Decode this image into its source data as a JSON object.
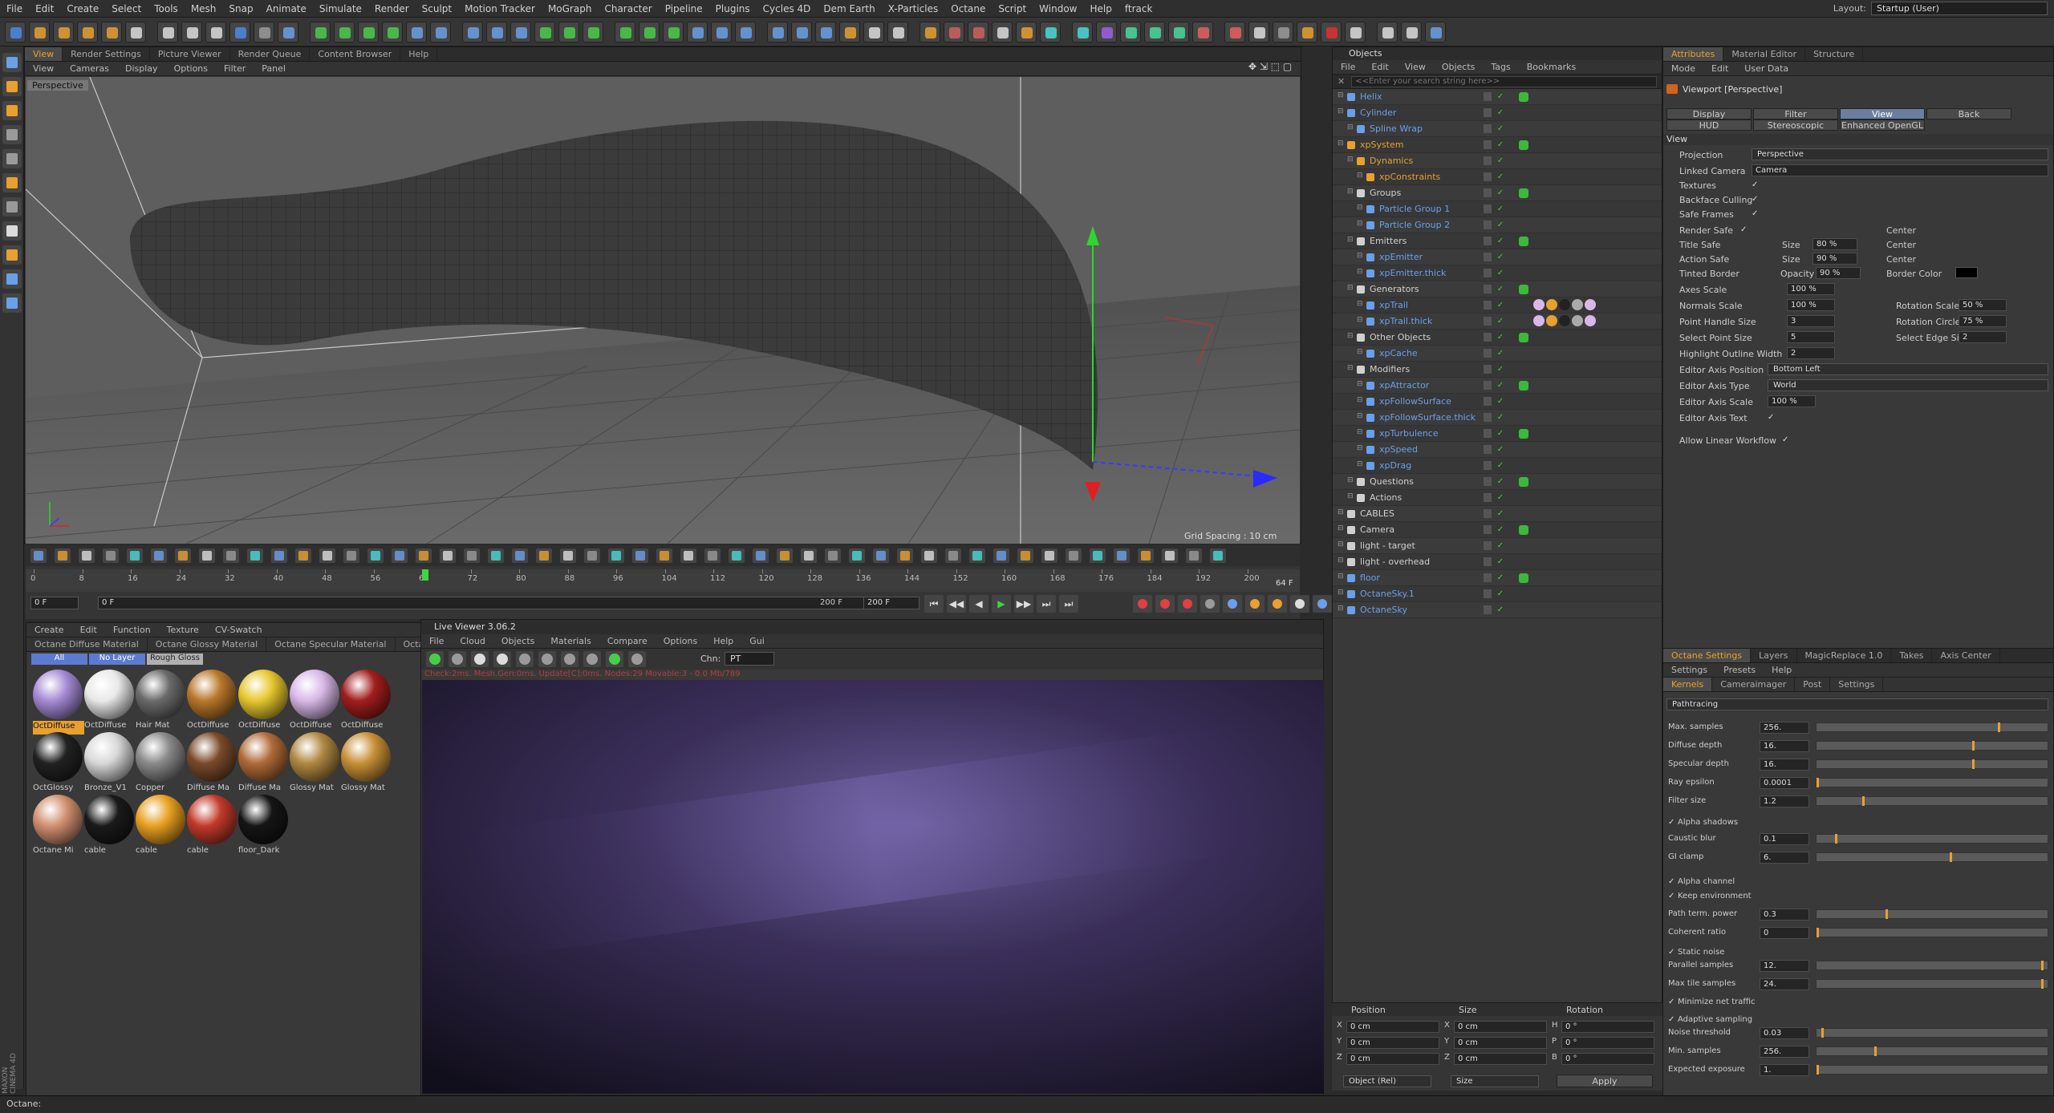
{
  "menu": [
    "File",
    "Edit",
    "Create",
    "Select",
    "Tools",
    "Mesh",
    "Snap",
    "Animate",
    "Simulate",
    "Render",
    "Sculpt",
    "Motion Tracker",
    "MoGraph",
    "Character",
    "Pipeline",
    "Plugins",
    "Cycles 4D",
    "Dem Earth",
    "X-Particles",
    "Octane",
    "Script",
    "Window",
    "Help",
    "ftrack"
  ],
  "layout": {
    "label": "Layout:",
    "value": "Startup (User)"
  },
  "viewport": {
    "tabs": [
      "View",
      "Render Settings",
      "Picture Viewer",
      "Render Queue",
      "Content Browser",
      "Help"
    ],
    "menu": [
      "View",
      "Cameras",
      "Display",
      "Options",
      "Filter",
      "Panel"
    ],
    "label": "Perspective",
    "grid_spacing": "Grid Spacing : 10 cm"
  },
  "timeline": {
    "ticks": [
      "0",
      "8",
      "16",
      "24",
      "32",
      "40",
      "48",
      "56",
      "64",
      "72",
      "80",
      "88",
      "96",
      "104",
      "112",
      "120",
      "128",
      "136",
      "144",
      "152",
      "160",
      "168",
      "176",
      "184",
      "192",
      "200"
    ],
    "current": "64 F",
    "start": "0 F",
    "start2": "0 F",
    "end": "200 F",
    "end2": "200 F"
  },
  "materials": {
    "menu": [
      "Create",
      "Edit",
      "Function",
      "Texture",
      "CV-Swatch"
    ],
    "tabs": [
      "Octane Diffuse Material",
      "Octane Glossy Material",
      "Octane Specular Material",
      "Octane M"
    ],
    "filters": [
      "All",
      "No Layer",
      "Rough Gloss"
    ],
    "items": [
      {
        "label": "OctDiffuse",
        "color": "#a78bd6"
      },
      {
        "label": "OctDiffuse",
        "color": "#e9e9e9"
      },
      {
        "label": "Hair Mat",
        "color": "#6b6b6b"
      },
      {
        "label": "OctDiffuse",
        "color": "#b8772a"
      },
      {
        "label": "OctDiffuse",
        "color": "#e7c72e"
      },
      {
        "label": "OctDiffuse",
        "color": "#d8b8e8"
      },
      {
        "label": "OctDiffuse",
        "color": "#a21d1d"
      },
      {
        "label": "OctGlossy",
        "color": "#222222"
      },
      {
        "label": "Bronze_V1",
        "color": "#d8d8d8"
      },
      {
        "label": "Copper",
        "color": "#8a8a8a"
      },
      {
        "label": "Diffuse Ma",
        "color": "#7a4a2a"
      },
      {
        "label": "Diffuse Ma",
        "color": "#b06a38"
      },
      {
        "label": "Glossy Mat",
        "color": "#b08840"
      },
      {
        "label": "Glossy Mat",
        "color": "#c89038"
      },
      {
        "label": "Octane Mi",
        "color": "#d29070"
      },
      {
        "label": "cable",
        "color": "#1a1a1a"
      },
      {
        "label": "cable",
        "color": "#e8a020"
      },
      {
        "label": "cable",
        "color": "#c23a2a"
      },
      {
        "label": "floor_Dark",
        "color": "#151515"
      }
    ]
  },
  "live_viewer": {
    "title": "Live Viewer 3.06.2",
    "menu": [
      "File",
      "Cloud",
      "Objects",
      "Materials",
      "Compare",
      "Options",
      "Help",
      "Gui"
    ],
    "chn_label": "Chn:",
    "chn_value": "PT",
    "status": "Check:2ms. Mesh.Gen:0ms. Update[C]:0ms. Nodes:29 Movable:3 - 0.0 Mb/789"
  },
  "objects": {
    "title": "Objects",
    "menu": [
      "File",
      "Edit",
      "View",
      "Objects",
      "Tags",
      "Bookmarks"
    ],
    "search_placeholder": "<<Enter your search string here>>",
    "rows": [
      {
        "name": "Helix",
        "indent": 0,
        "color": "#6aa0e8"
      },
      {
        "name": "Cylinder",
        "indent": 0,
        "color": "#6aa0e8"
      },
      {
        "name": "Spline Wrap",
        "indent": 1,
        "color": "#6aa0e8"
      },
      {
        "name": "xpSystem",
        "indent": 0,
        "color": "#e8a030"
      },
      {
        "name": "Dynamics",
        "indent": 1,
        "color": "#e8a030"
      },
      {
        "name": "xpConstraints",
        "indent": 2,
        "color": "#e8a030"
      },
      {
        "name": "Groups",
        "indent": 1,
        "color": "#d0d0d0"
      },
      {
        "name": "Particle Group 1",
        "indent": 2,
        "color": "#6aa0e8"
      },
      {
        "name": "Particle Group 2",
        "indent": 2,
        "color": "#6aa0e8"
      },
      {
        "name": "Emitters",
        "indent": 1,
        "color": "#d0d0d0"
      },
      {
        "name": "xpEmitter",
        "indent": 2,
        "color": "#6aa0e8"
      },
      {
        "name": "xpEmitter.thick",
        "indent": 2,
        "color": "#6aa0e8"
      },
      {
        "name": "Generators",
        "indent": 1,
        "color": "#d0d0d0"
      },
      {
        "name": "xpTrail",
        "indent": 2,
        "color": "#6aa0e8"
      },
      {
        "name": "xpTrail.thick",
        "indent": 2,
        "color": "#6aa0e8"
      },
      {
        "name": "Other Objects",
        "indent": 1,
        "color": "#d0d0d0"
      },
      {
        "name": "xpCache",
        "indent": 2,
        "color": "#6aa0e8"
      },
      {
        "name": "Modifiers",
        "indent": 1,
        "color": "#d0d0d0"
      },
      {
        "name": "xpAttractor",
        "indent": 2,
        "color": "#6aa0e8"
      },
      {
        "name": "xpFollowSurface",
        "indent": 2,
        "color": "#6aa0e8"
      },
      {
        "name": "xpFollowSurface.thick",
        "indent": 2,
        "color": "#6aa0e8"
      },
      {
        "name": "xpTurbulence",
        "indent": 2,
        "color": "#6aa0e8"
      },
      {
        "name": "xpSpeed",
        "indent": 2,
        "color": "#6aa0e8"
      },
      {
        "name": "xpDrag",
        "indent": 2,
        "color": "#6aa0e8"
      },
      {
        "name": "Questions",
        "indent": 1,
        "color": "#d0d0d0"
      },
      {
        "name": "Actions",
        "indent": 1,
        "color": "#d0d0d0"
      },
      {
        "name": "CABLES",
        "indent": 0,
        "color": "#d0d0d0"
      },
      {
        "name": "Camera",
        "indent": 0,
        "color": "#d0d0d0"
      },
      {
        "name": "light - target",
        "indent": 0,
        "color": "#d0d0d0"
      },
      {
        "name": "light - overhead",
        "indent": 0,
        "color": "#d0d0d0"
      },
      {
        "name": "floor",
        "indent": 0,
        "color": "#6aa0e8"
      },
      {
        "name": "OctaneSky.1",
        "indent": 0,
        "color": "#6aa0e8"
      },
      {
        "name": "OctaneSky",
        "indent": 0,
        "color": "#6aa0e8"
      }
    ]
  },
  "coords": {
    "headers": [
      "Position",
      "Size",
      "Rotation"
    ],
    "rows": [
      {
        "axis": "X",
        "pos": "0 cm",
        "size_axis": "X",
        "size": "0 cm",
        "rot_axis": "H",
        "rot": "0 °"
      },
      {
        "axis": "Y",
        "pos": "0 cm",
        "size_axis": "Y",
        "size": "0 cm",
        "rot_axis": "P",
        "rot": "0 °"
      },
      {
        "axis": "Z",
        "pos": "0 cm",
        "size_axis": "Z",
        "size": "0 cm",
        "rot_axis": "B",
        "rot": "0 °"
      }
    ],
    "mode": "Object (Rel)",
    "size_mode": "Size",
    "apply": "Apply"
  },
  "attributes": {
    "tabs": [
      "Attributes",
      "Material Editor",
      "Structure"
    ],
    "menu": [
      "Mode",
      "Edit",
      "User Data"
    ],
    "title": "Viewport [Perspective]",
    "buttons": [
      "Display",
      "Filter",
      "View",
      "Back",
      "HUD",
      "Stereoscopic",
      "Enhanced OpenGL"
    ],
    "section": "View",
    "projection_label": "Projection",
    "projection": "Perspective",
    "linked_camera_label": "Linked Camera",
    "linked_camera": "Camera",
    "checks": [
      "Textures",
      "Backface Culling",
      "Safe Frames"
    ],
    "render_safe": "Render Safe",
    "title_safe": "Title Safe",
    "action_safe": "Action Safe",
    "tinted_border": "Tinted Border",
    "size_label": "Size",
    "center_label": "Center",
    "size1": "80 %",
    "size2": "90 %",
    "opacity_label": "Opacity",
    "opacity": "90 %",
    "border_color": "Border Color",
    "axes_scale_label": "Axes Scale",
    "axes_scale": "100 %",
    "normals_scale_label": "Normals Scale",
    "normals_scale": "100 %",
    "rotation_scale_label": "Rotation Scale",
    "rotation_scale": "50 %",
    "point_handle_label": "Point Handle Size",
    "point_handle": "3",
    "rotation_circle_label": "Rotation Circle",
    "rotation_circle": "75 %",
    "select_point_label": "Select Point Size",
    "select_point": "5",
    "select_edge_label": "Select Edge Size",
    "select_edge": "2",
    "highlight_label": "Highlight Outline Width",
    "highlight": "2",
    "axis_pos_label": "Editor Axis Position",
    "axis_pos": "Bottom Left",
    "axis_type_label": "Editor Axis Type",
    "axis_type": "World",
    "axis_scale_label": "Editor Axis Scale",
    "axis_scale": "100 %",
    "axis_text_label": "Editor Axis Text",
    "linear_label": "Allow Linear Workflow"
  },
  "octane": {
    "tabs": [
      "Octane Settings",
      "Layers",
      "MagicReplace 1.0",
      "Takes",
      "Axis Center"
    ],
    "menu": [
      "Settings",
      "Presets",
      "Help"
    ],
    "subtabs": [
      "Kernels",
      "Cameraimager",
      "Post",
      "Settings"
    ],
    "kernel": "Pathtracing",
    "params": [
      {
        "label": "Max. samples",
        "value": "256.",
        "frac": 0.79
      },
      {
        "label": "Diffuse depth",
        "value": "16.",
        "frac": 0.68
      },
      {
        "label": "Specular depth",
        "value": "16.",
        "frac": 0.68
      },
      {
        "label": "Ray epsilon",
        "value": "0.0001",
        "frac": 0.0
      },
      {
        "label": "Filter size",
        "value": "1.2",
        "frac": 0.2
      }
    ],
    "alpha_shadows": "Alpha shadows",
    "params2": [
      {
        "label": "Caustic blur",
        "value": "0.1",
        "frac": 0.08
      },
      {
        "label": "GI clamp",
        "value": "6.",
        "frac": 0.58
      }
    ],
    "alpha_channel": "Alpha channel",
    "keep_env": "Keep environment",
    "params3": [
      {
        "label": "Path term. power",
        "value": "0.3",
        "frac": 0.3
      },
      {
        "label": "Coherent ratio",
        "value": "0",
        "frac": 0.0
      }
    ],
    "static_noise": "Static noise",
    "params4": [
      {
        "label": "Parallel samples",
        "value": "12.",
        "frac": 0.98
      },
      {
        "label": "Max tile samples",
        "value": "24.",
        "frac": 0.98
      }
    ],
    "minimize": "Minimize net traffic",
    "adaptive": "Adaptive sampling",
    "params5": [
      {
        "label": "Noise threshold",
        "value": "0.03",
        "frac": 0.02
      },
      {
        "label": "Min. samples",
        "value": "256.",
        "frac": 0.25
      },
      {
        "label": "Expected exposure",
        "value": "1.",
        "frac": 0.0
      }
    ]
  },
  "status": "Octane:",
  "brand": "MAXON CINEMA 4D"
}
